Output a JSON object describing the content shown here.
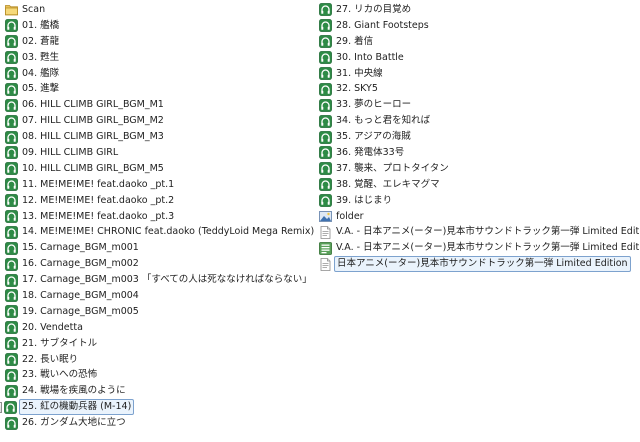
{
  "file_list": {
    "left_column": [
      {
        "name": "Scan",
        "icon": "folder-icon",
        "kind": "folder"
      },
      {
        "name": "01. 艦橋",
        "icon": "audio-file-icon",
        "kind": "audio"
      },
      {
        "name": "02. 蒼龍",
        "icon": "audio-file-icon",
        "kind": "audio"
      },
      {
        "name": "03. 甦生",
        "icon": "audio-file-icon",
        "kind": "audio"
      },
      {
        "name": "04. 艦隊",
        "icon": "audio-file-icon",
        "kind": "audio"
      },
      {
        "name": "05. 進撃",
        "icon": "audio-file-icon",
        "kind": "audio"
      },
      {
        "name": "06. HILL CLIMB GIRL_BGM_M1",
        "icon": "audio-file-icon",
        "kind": "audio"
      },
      {
        "name": "07. HILL CLIMB GIRL_BGM_M2",
        "icon": "audio-file-icon",
        "kind": "audio"
      },
      {
        "name": "08. HILL CLIMB GIRL_BGM_M3",
        "icon": "audio-file-icon",
        "kind": "audio"
      },
      {
        "name": "09. HILL CLIMB GIRL",
        "icon": "audio-file-icon",
        "kind": "audio"
      },
      {
        "name": "10. HILL CLIMB GIRL_BGM_M5",
        "icon": "audio-file-icon",
        "kind": "audio"
      },
      {
        "name": "11. ME!ME!ME! feat.daoko _pt.1",
        "icon": "audio-file-icon",
        "kind": "audio"
      },
      {
        "name": "12. ME!ME!ME! feat.daoko _pt.2",
        "icon": "audio-file-icon",
        "kind": "audio"
      },
      {
        "name": "13. ME!ME!ME! feat.daoko _pt.3",
        "icon": "audio-file-icon",
        "kind": "audio"
      },
      {
        "name": "14. ME!ME!ME! CHRONIC feat.daoko (TeddyLoid Mega Remix)",
        "icon": "audio-file-icon",
        "kind": "audio"
      },
      {
        "name": "15. Carnage_BGM_m001",
        "icon": "audio-file-icon",
        "kind": "audio"
      },
      {
        "name": "16. Carnage_BGM_m002",
        "icon": "audio-file-icon",
        "kind": "audio"
      },
      {
        "name": "17. Carnage_BGM_m003 「すべての人は死ななければならない」",
        "icon": "audio-file-icon",
        "kind": "audio"
      },
      {
        "name": "18. Carnage_BGM_m004",
        "icon": "audio-file-icon",
        "kind": "audio"
      },
      {
        "name": "19. Carnage_BGM_m005",
        "icon": "audio-file-icon",
        "kind": "audio"
      },
      {
        "name": "20. Vendetta",
        "icon": "audio-file-icon",
        "kind": "audio"
      },
      {
        "name": "21. サブタイトル",
        "icon": "audio-file-icon",
        "kind": "audio"
      },
      {
        "name": "22. 長い眠り",
        "icon": "audio-file-icon",
        "kind": "audio"
      },
      {
        "name": "23. 戦いへの恐怖",
        "icon": "audio-file-icon",
        "kind": "audio"
      },
      {
        "name": "24. 戦場を疾風のように",
        "icon": "audio-file-icon",
        "kind": "audio"
      },
      {
        "name": "25. 紅の機動兵器 (M-14)",
        "icon": "audio-file-icon",
        "kind": "audio",
        "selected": true,
        "checkbox": true
      },
      {
        "name": "26. ガンダム大地に立つ",
        "icon": "audio-file-icon",
        "kind": "audio"
      }
    ],
    "right_column": [
      {
        "name": "27. リカの目覚め",
        "icon": "audio-file-icon",
        "kind": "audio"
      },
      {
        "name": "28. Giant Footsteps",
        "icon": "audio-file-icon",
        "kind": "audio"
      },
      {
        "name": "29. 着信",
        "icon": "audio-file-icon",
        "kind": "audio"
      },
      {
        "name": "30. Into Battle",
        "icon": "audio-file-icon",
        "kind": "audio"
      },
      {
        "name": "31. 中央線",
        "icon": "audio-file-icon",
        "kind": "audio"
      },
      {
        "name": "32. SKY5",
        "icon": "audio-file-icon",
        "kind": "audio"
      },
      {
        "name": "33. 夢のヒーロー",
        "icon": "audio-file-icon",
        "kind": "audio"
      },
      {
        "name": "34. もっと君を知れば",
        "icon": "audio-file-icon",
        "kind": "audio"
      },
      {
        "name": "35. アジアの海賊",
        "icon": "audio-file-icon",
        "kind": "audio"
      },
      {
        "name": "36. 発電体33号",
        "icon": "audio-file-icon",
        "kind": "audio"
      },
      {
        "name": "37. 襲来、プロトタイタン",
        "icon": "audio-file-icon",
        "kind": "audio"
      },
      {
        "name": "38. 覚醒、エレキマグマ",
        "icon": "audio-file-icon",
        "kind": "audio"
      },
      {
        "name": "39. はじまり",
        "icon": "audio-file-icon",
        "kind": "audio"
      },
      {
        "name": "folder",
        "icon": "image-file-icon",
        "kind": "image"
      },
      {
        "name": "V.A. - 日本アニメ(ーター)見本市サウンドトラック第一弾 Limited Edition",
        "icon": "text-document-icon",
        "kind": "document"
      },
      {
        "name": "V.A. - 日本アニメ(ーター)見本市サウンドトラック第一弾 Limited Edition",
        "icon": "playlist-file-icon",
        "kind": "playlist"
      },
      {
        "name": "日本アニメ(ーター)見本市サウンドトラック第一弾 Limited Edition",
        "icon": "text-document-icon",
        "kind": "document",
        "selected": true
      }
    ]
  },
  "colors": {
    "audio_icon": "#2e8b46",
    "folder_icon": "#e8c25a",
    "selection_border": "#7da2ce",
    "selection_fill": "#eaf3fc",
    "text": "#1e1e1e"
  }
}
